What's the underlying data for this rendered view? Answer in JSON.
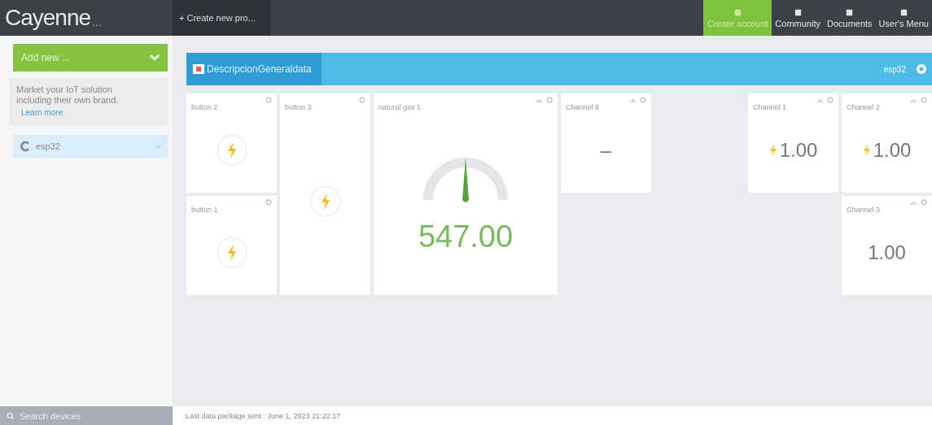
{
  "header": {
    "logo": "Cayenne",
    "logo_suffix": "...",
    "create_button": "+ Create new pro...",
    "nav": [
      {
        "label": "Create account",
        "selected": true
      },
      {
        "label": "Community",
        "selected": false
      },
      {
        "label": "Documents",
        "selected": false
      },
      {
        "label": "User's Menu",
        "selected": false
      }
    ]
  },
  "sidebar": {
    "add_button": "Add new ...",
    "promo": {
      "text": "Market your IoT solution including their own brand.",
      "link": "Learn more"
    },
    "devices": [
      {
        "name": "esp32",
        "selected": true
      }
    ],
    "search": {
      "placeholder": "Search devices"
    }
  },
  "dashboard": {
    "tab": "DescripcionGeneraldata",
    "device": "esp32",
    "widgets": [
      {
        "kind": "button",
        "title": "button 2"
      },
      {
        "kind": "button",
        "title": "button 1"
      },
      {
        "kind": "button",
        "title": "button 3"
      },
      {
        "kind": "gauge",
        "title": "natural gas 1",
        "value": "547.00",
        "level": 0.5
      },
      {
        "kind": "value",
        "title": "Channel 6",
        "value": "–"
      },
      {
        "kind": "bolt_value",
        "title": "Channel 1",
        "value": "1.00"
      },
      {
        "kind": "bolt_value",
        "title": "Channel 2",
        "value": "1.00"
      },
      {
        "kind": "value",
        "title": "Channel 3",
        "value": "1.00"
      }
    ]
  },
  "status_bar": "Last data package sent : June 1, 2023 21:22:17"
}
